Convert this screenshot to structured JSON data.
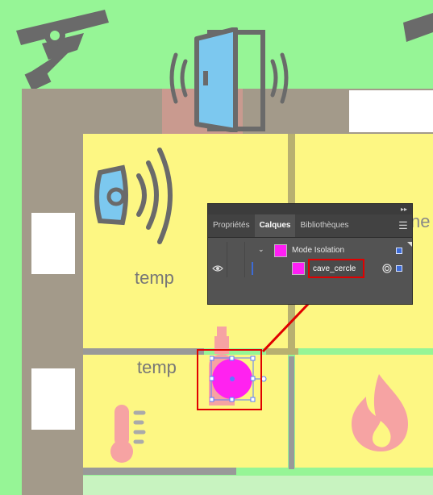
{
  "canvas": {
    "room_labels": [
      "temp",
      "temp"
    ],
    "partial_label": "ne",
    "selected_object_color": "#ff22f0",
    "highlight_color": "#e00000"
  },
  "icons": [
    "security-camera-icon",
    "door-sensor-icon",
    "smart-doorbell-icon",
    "thermometer-icon",
    "fire-icon",
    "bottle-icon"
  ],
  "layers_panel": {
    "tabs": [
      {
        "label": "Propriétés",
        "active": false
      },
      {
        "label": "Calques",
        "active": true
      },
      {
        "label": "Bibliothèques",
        "active": false
      }
    ],
    "group_row": {
      "name": "Mode Isolation"
    },
    "layer_row": {
      "name": "cave_cercle"
    }
  }
}
